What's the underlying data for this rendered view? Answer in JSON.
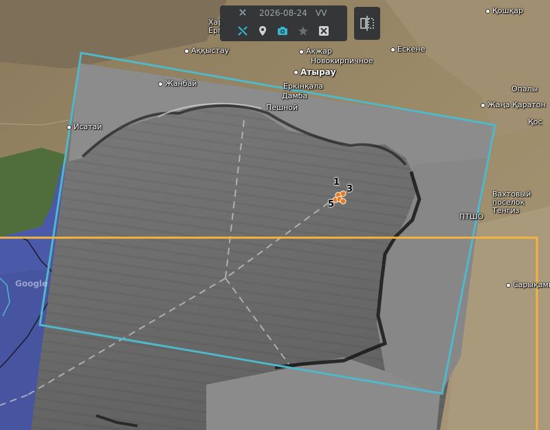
{
  "toolbar": {
    "date": "2026-08-24",
    "polarization": "VV",
    "satellite_icon": "satellite-icon",
    "buttons": [
      "satellite-icon",
      "location-pin-icon",
      "camera-icon",
      "star-icon",
      "crop-icon"
    ],
    "compare_icon": "split-compare-icon"
  },
  "places": {
    "koshkar": "Қошқар",
    "khar": "Хар",
    "erg": "Ерг",
    "akkystau": "Аққыстау",
    "akzhar": "Акжар",
    "eskene": "Ескене",
    "novokirpichnoe": "Новокирпичное",
    "atyrau": "Атырау",
    "zhanbai": "Жанбай",
    "erkinkala": "Еркінқала",
    "damba": "Дамба",
    "peshnoy": "Пешной",
    "opaly": "Опалы",
    "zhana_karaton": "Жаңа Қаратон",
    "kos": "Қос",
    "isatay": "Исатай",
    "bakhtovy_1": "Вахтовый",
    "bakhtovy_2": "поселок",
    "bakhtovy_3": "Тенгиз",
    "ptsho": "ПТШО",
    "sarykamys": "Сарықамы",
    "google": "Google"
  },
  "markers": [
    "1",
    "3",
    "5"
  ],
  "colors": {
    "footprint_cyan": "#4fb8c9",
    "aoi_yellow": "#f2b640",
    "marker_orange": "#e8781e",
    "sea_blue": "#4a5aa8",
    "toolbar_bg": "#2d3034",
    "icon_active": "#39b4cf",
    "icon_inactive": "#cfd3d6"
  }
}
